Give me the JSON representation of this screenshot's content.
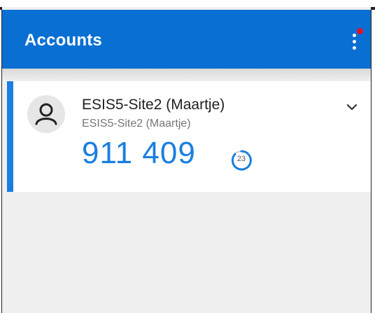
{
  "appbar": {
    "title": "Accounts",
    "menu_icon": "more-vertical-icon",
    "notification_color": "#e81123"
  },
  "colors": {
    "primary": "#0a6fd3",
    "accent": "#1a7ee0",
    "background": "#f0f0f0"
  },
  "accounts": [
    {
      "name": "ESIS5-Site2 (Maartje)",
      "subtitle": "ESIS5-Site2 (Maartje)",
      "code": "911 409",
      "seconds_remaining": "23",
      "avatar_icon": "person-icon",
      "expand_icon": "chevron-down-icon"
    }
  ]
}
